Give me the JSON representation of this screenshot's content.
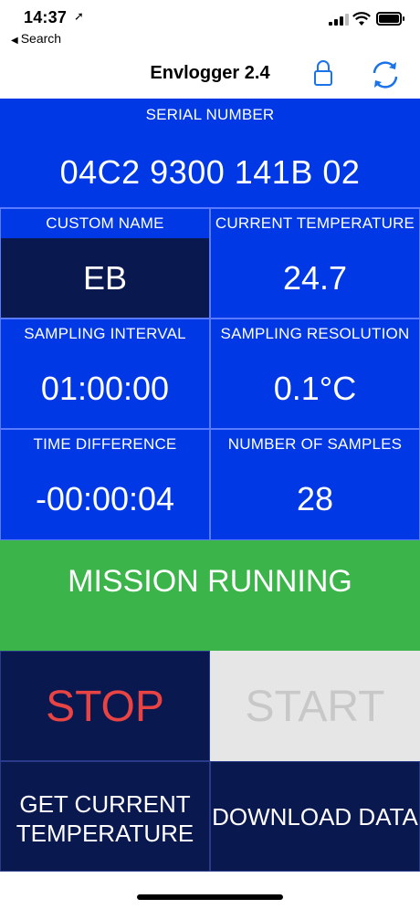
{
  "status_bar": {
    "time": "14:37",
    "location_icon": "location-arrow-icon",
    "back_label": "Search"
  },
  "nav": {
    "title": "Envlogger 2.4",
    "lock_icon": "lock-icon",
    "sync_icon": "sync-icon"
  },
  "serial": {
    "label": "SERIAL NUMBER",
    "value": "04C2 9300 141B 02"
  },
  "custom_name": {
    "label": "CUSTOM NAME",
    "value": "EB"
  },
  "current_temperature": {
    "label": "CURRENT TEMPERATURE",
    "value": "24.7"
  },
  "sampling_interval": {
    "label": "SAMPLING INTERVAL",
    "value": "01:00:00"
  },
  "sampling_resolution": {
    "label": "SAMPLING RESOLUTION",
    "value": "0.1°C"
  },
  "time_difference": {
    "label": "TIME DIFFERENCE",
    "value": "-00:00:04"
  },
  "number_of_samples": {
    "label": "NUMBER OF SAMPLES",
    "value": "28"
  },
  "mission_status": "MISSION RUNNING",
  "buttons": {
    "stop": "STOP",
    "start": "START",
    "get_temp_line1": "GET CURRENT",
    "get_temp_line2": "TEMPERATURE",
    "download": "DOWNLOAD DATA"
  },
  "colors": {
    "panel_blue": "#0038e6",
    "dark_navy": "#0a1850",
    "mission_green": "#3bb54a",
    "stop_red": "#e84444",
    "start_disabled": "#c8c8c8"
  }
}
